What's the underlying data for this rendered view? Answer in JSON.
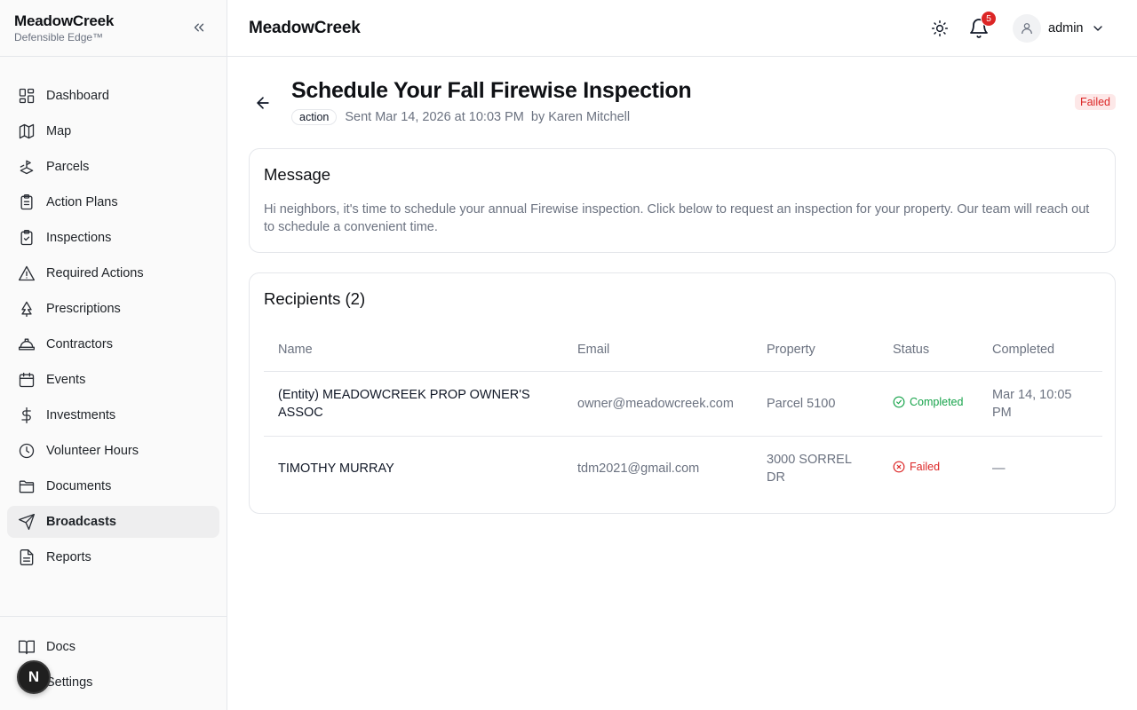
{
  "brand": {
    "title": "MeadowCreek",
    "subtitle": "Defensible Edge™"
  },
  "sidebar": {
    "items": [
      {
        "label": "Dashboard",
        "icon": "dashboard-icon"
      },
      {
        "label": "Map",
        "icon": "map-icon"
      },
      {
        "label": "Parcels",
        "icon": "parcels-icon"
      },
      {
        "label": "Action Plans",
        "icon": "clipboard-icon"
      },
      {
        "label": "Inspections",
        "icon": "clipboard-check-icon"
      },
      {
        "label": "Required Actions",
        "icon": "warning-icon"
      },
      {
        "label": "Prescriptions",
        "icon": "tree-icon"
      },
      {
        "label": "Contractors",
        "icon": "hard-hat-icon"
      },
      {
        "label": "Events",
        "icon": "calendar-icon"
      },
      {
        "label": "Investments",
        "icon": "dollar-icon"
      },
      {
        "label": "Volunteer Hours",
        "icon": "clock-icon"
      },
      {
        "label": "Documents",
        "icon": "folder-icon"
      },
      {
        "label": "Broadcasts",
        "icon": "send-icon",
        "active": true
      },
      {
        "label": "Reports",
        "icon": "file-text-icon"
      }
    ],
    "bottom": [
      {
        "label": "Docs",
        "icon": "book-icon"
      },
      {
        "label": "Settings",
        "icon": "settings-icon"
      }
    ],
    "fab_label": "N"
  },
  "header": {
    "title": "MeadowCreek",
    "notifications_count": "5",
    "user": "admin"
  },
  "broadcast": {
    "title": "Schedule Your Fall Firewise Inspection",
    "tag": "action",
    "sent": "Sent Mar 14, 2026 at 10:03 PM",
    "author": "by Karen Mitchell",
    "status": "Failed",
    "message_heading": "Message",
    "message": "Hi neighbors, it's time to schedule your annual Firewise inspection. Click below to request an inspection for your property. Our team will reach out to schedule a convenient time."
  },
  "recipients": {
    "heading": "Recipients (2)",
    "columns": [
      "Name",
      "Email",
      "Property",
      "Status",
      "Completed"
    ],
    "rows": [
      {
        "name": "(Entity) MEADOWCREEK PROP OWNER'S ASSOC",
        "email": "owner@meadowcreek.com",
        "property": "Parcel 5100",
        "status": "Completed",
        "completed": "Mar 14, 10:05 PM"
      },
      {
        "name": "TIMOTHY MURRAY",
        "email": "tdm2021@gmail.com",
        "property": "3000 SORREL DR",
        "status": "Failed",
        "completed": "—"
      }
    ]
  },
  "colors": {
    "success": "#16a34a",
    "danger": "#dc2626",
    "active_bg": "#eeeeef"
  }
}
